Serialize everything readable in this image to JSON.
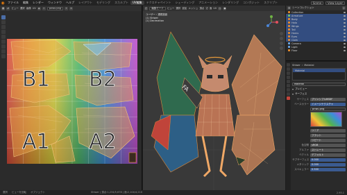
{
  "topbar": {
    "menus": [
      "ファイル",
      "編集",
      "レンダー",
      "ウィンドウ",
      "ヘルプ"
    ],
    "workspaces": [
      "レイアウト",
      "モデリング",
      "スカルプト",
      "UV編集",
      "テクスチャペイント",
      "シェーディング",
      "アニメーション",
      "レンダリング",
      "コンポジット",
      "スクリプト"
    ],
    "active_workspace": "UV編集",
    "scene": "Scene",
    "view_layer": "View Layer"
  },
  "uv_editor": {
    "view_menu": "ビュー",
    "select_menu": "選択",
    "image_menu": "画像",
    "uv_menu": "UV",
    "image_name": "pnwu.png",
    "grid_labels": [
      "B1",
      "B2",
      "A1",
      "A2"
    ]
  },
  "viewport": {
    "mode": "編集モード",
    "menus": [
      "ビュー",
      "選択",
      "追加",
      "メッシュ",
      "頂点",
      "辺",
      "面",
      "UV"
    ],
    "info_line1": "ユーザー・透視投影",
    "info_line2": "(1) Shiwer",
    "info_line3": "(1) Decimation"
  },
  "outliner": {
    "title": "シーンコレクション",
    "rows": [
      {
        "label": "Collection",
        "icon": "collection-icon",
        "selected": false
      },
      {
        "label": "Armature",
        "icon": "armature-icon",
        "selected": true
      },
      {
        "label": "Body",
        "icon": "mesh-icon",
        "selected": true
      },
      {
        "label": "Halo",
        "icon": "mesh-icon",
        "selected": true
      },
      {
        "label": "Wings",
        "icon": "mesh-icon",
        "selected": true
      },
      {
        "label": "Tail",
        "icon": "mesh-icon",
        "selected": true
      },
      {
        "label": "Horns",
        "icon": "mesh-icon",
        "selected": true
      },
      {
        "label": "Eyes",
        "icon": "mesh-icon",
        "selected": true
      },
      {
        "label": "Cloth",
        "icon": "mesh-icon",
        "selected": true
      },
      {
        "label": "Camera",
        "icon": "camera-icon",
        "selected": false
      },
      {
        "label": "Light",
        "icon": "light-icon",
        "selected": false
      },
      {
        "label": "Floor",
        "icon": "mesh-icon",
        "selected": false
      }
    ]
  },
  "properties": {
    "object_name": "Shiwer",
    "tab_label": "Material",
    "material_item": "Material",
    "material_field": "Material",
    "section_preview": "プレビュー",
    "section_surface": "サーフェス",
    "surface_label": "サーフェス",
    "surface_value": "プリンシプルBSDF",
    "basecolor_label": "ベースカラー",
    "basecolor_value": "イメージテクスチャ",
    "image_value": "pnwu.png",
    "interp_value": "リニア",
    "proj_value": "フラット",
    "ext_value": "リピート",
    "colorspace_label": "色空間",
    "colorspace_value": "sRGB",
    "alpha_label": "アルファ",
    "alpha_value": "ストレート",
    "vector_label": "ベクトル",
    "vector_value": "デフォルト",
    "subsurface_label": "サブサーフェス",
    "subsurface_value": "0.000",
    "metallic_label": "メタリック",
    "metallic_value": "0.000",
    "specular_label": "スペキュラー",
    "specular_value": "0.500"
  },
  "status": {
    "left1": "選択",
    "left2": "ビューを回転",
    "left3": "オブジェクト",
    "mid": "Shiwer | 頂点:1,234/5,678 | 面:2,104/4,210",
    "right": "2.93.1"
  },
  "colors": {
    "accent_orange": "#e87d0d",
    "selection_blue": "#334d80",
    "active_tab_red": "#c4463c"
  }
}
